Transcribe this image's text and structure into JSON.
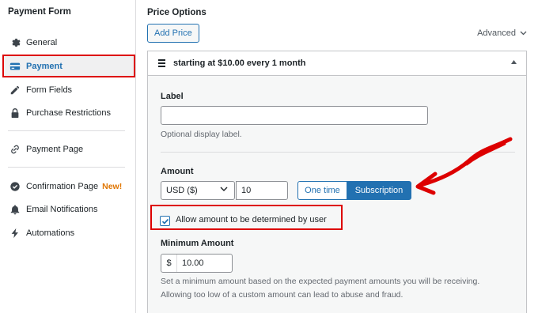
{
  "sidebar": {
    "title": "Payment Form",
    "items": [
      {
        "label": "General",
        "icon": "gear-icon"
      },
      {
        "label": "Payment",
        "icon": "credit-card-icon"
      },
      {
        "label": "Form Fields",
        "icon": "pencil-icon"
      },
      {
        "label": "Purchase Restrictions",
        "icon": "lock-icon"
      },
      {
        "label": "Payment Page",
        "icon": "link-icon"
      },
      {
        "label": "Confirmation Page",
        "icon": "check-circle-icon",
        "badge": "New!"
      },
      {
        "label": "Email Notifications",
        "icon": "bell-icon"
      },
      {
        "label": "Automations",
        "icon": "bolt-icon"
      }
    ]
  },
  "price_options": {
    "title": "Price Options",
    "add_button": "Add Price",
    "advanced": "Advanced",
    "panel_title": "starting at $10.00 every 1 month",
    "label_heading": "Label",
    "label_value": "",
    "label_help": "Optional display label.",
    "amount_heading": "Amount",
    "currency": "USD ($)",
    "amount_value": "10",
    "one_time_label": "One time",
    "subscription_label": "Subscription",
    "allow_user_amount_label": "Allow amount to be determined by user",
    "allow_user_amount_checked": true,
    "min_amount_heading": "Minimum Amount",
    "min_currency_symbol": "$",
    "min_amount_value": "10.00",
    "min_help_line1": "Set a minimum amount based on the expected payment amounts you will be receiving.",
    "min_help_line2": "Allowing too low of a custom amount can lead to abuse and fraud."
  },
  "colors": {
    "accent": "#2271b1",
    "highlight": "#dd0000",
    "new_badge": "#e07500"
  }
}
